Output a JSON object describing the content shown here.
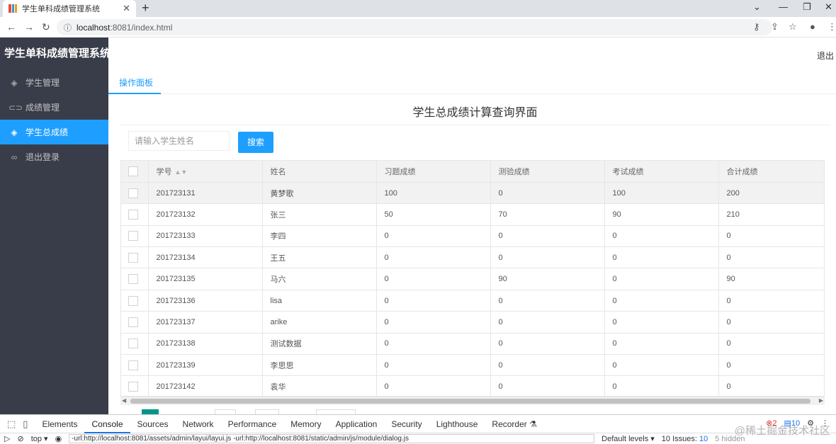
{
  "browser": {
    "tab_title": "学生单科成绩管理系统",
    "url_host": "localhost",
    "url_rest": ":8081/index.html"
  },
  "sidebar": {
    "brand": "学生单科成绩管理系统",
    "items": [
      {
        "label": "学生管理",
        "icon": "layers-icon"
      },
      {
        "label": "成绩管理",
        "icon": "link-icon"
      },
      {
        "label": "学生总成绩",
        "icon": "layers-icon"
      },
      {
        "label": "退出登录",
        "icon": "infinity-icon"
      }
    ],
    "active_index": 2
  },
  "header": {
    "logout": "退出"
  },
  "tabs": {
    "active": "操作面板"
  },
  "page": {
    "title": "学生总成绩计算查询界面"
  },
  "search": {
    "placeholder": "请输入学生姓名",
    "button": "搜索"
  },
  "table": {
    "columns": [
      "学号",
      "姓名",
      "习题成绩",
      "测验成绩",
      "考试成绩",
      "合计成绩"
    ],
    "rows": [
      [
        "201723131",
        "黄梦歌",
        "100",
        "0",
        "100",
        "200"
      ],
      [
        "201723132",
        "张三",
        "50",
        "70",
        "90",
        "210"
      ],
      [
        "201723133",
        "李四",
        "0",
        "0",
        "0",
        "0"
      ],
      [
        "201723134",
        "王五",
        "0",
        "0",
        "0",
        "0"
      ],
      [
        "201723135",
        "马六",
        "0",
        "90",
        "0",
        "90"
      ],
      [
        "201723136",
        "lisa",
        "0",
        "0",
        "0",
        "0"
      ],
      [
        "201723137",
        "arike",
        "0",
        "0",
        "0",
        "0"
      ],
      [
        "201723138",
        "测试数据",
        "0",
        "0",
        "0",
        "0"
      ],
      [
        "201723139",
        "李思思",
        "0",
        "0",
        "0",
        "0"
      ],
      [
        "201723142",
        "袁华",
        "0",
        "0",
        "0",
        "0"
      ]
    ]
  },
  "devtools": {
    "tabs": [
      "Elements",
      "Console",
      "Sources",
      "Network",
      "Performance",
      "Memory",
      "Application",
      "Security",
      "Lighthouse",
      "Recorder"
    ],
    "active_tab": "Console",
    "errors": "2",
    "messages": "10",
    "context": "top",
    "filter_text": "-url:http://localhost:8081/assets/admin/layui/layui.js -url:http://localhost:8081/static/admin/js/module/dialog.js",
    "levels": "Default levels",
    "issues_label": "10 Issues:",
    "issues_count": "10",
    "hidden": "5 hidden"
  },
  "watermark": "@稀土掘金技术社区"
}
